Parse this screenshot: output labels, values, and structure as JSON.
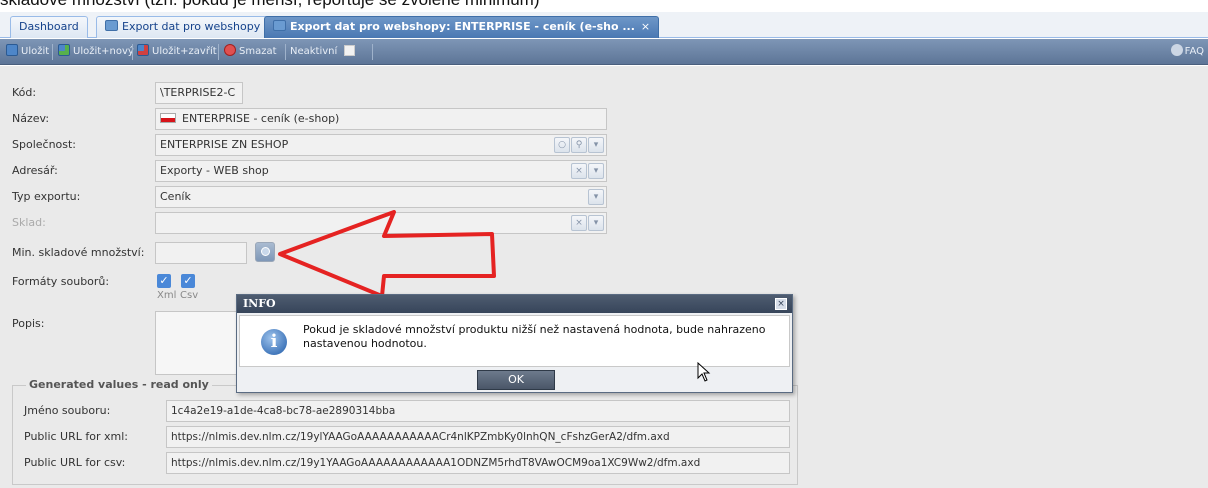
{
  "caption": "skladové množství (tzn. pokud je menší, reportuje se zvolené minimum)",
  "tabs": [
    {
      "label": "Dashboard"
    },
    {
      "label": "Export dat pro webshopy",
      "close": "⊠"
    },
    {
      "label": "Export dat pro webshopy: ENTERPRISE - ceník (e-sho ...",
      "close": "×"
    }
  ],
  "toolbar": {
    "save": "Uložit",
    "save_new": "Uložit+nový",
    "save_close": "Uložit+zavřít",
    "delete": "Smazat",
    "inactive": "Neaktivní",
    "help": "FAQ"
  },
  "form": {
    "code_label": "Kód:",
    "code_value": "\\TERPRISE2-C",
    "name_label": "Název:",
    "name_value": "ENTERPRISE - ceník (e-shop)",
    "company_label": "Společnost:",
    "company_value": "ENTERPRISE ZN ESHOP",
    "directory_label": "Adresář:",
    "directory_value": "Exporty - WEB shop",
    "export_type_label": "Typ exportu:",
    "export_type_value": "Ceník",
    "warehouse_label": "Sklad:",
    "min_stock_label": "Min. skladové množství:",
    "formats_label": "Formáty souborů:",
    "format_xml": "Xml",
    "format_csv": "Csv",
    "description_label": "Popis:",
    "generated_legend": "Generated values - read only",
    "filename_label": "Jméno souboru:",
    "filename_value": "1c4a2e19-a1de-4ca8-bc78-ae2890314bba",
    "url_xml_label": "Public URL for xml:",
    "url_xml_value": "https://nlmis.dev.nlm.cz/19ylYAAGoAAAAAAAAAAACr4nlKPZmbKy0lnhQN_cFshzGerA2/dfm.axd",
    "url_csv_label": "Public URL for csv:",
    "url_csv_value": "https://nlmis.dev.nlm.cz/19y1YAAGoAAAAAAAAAAAA1ODNZM5rhdT8VAwOCM9oa1XC9Ww2/dfm.axd"
  },
  "dialog": {
    "title": "INFO",
    "message": "Pokud je skladové množství produktu nižší než nastavená hodnota, bude nahrazeno nastavenou hodnotou.",
    "ok": "OK"
  }
}
